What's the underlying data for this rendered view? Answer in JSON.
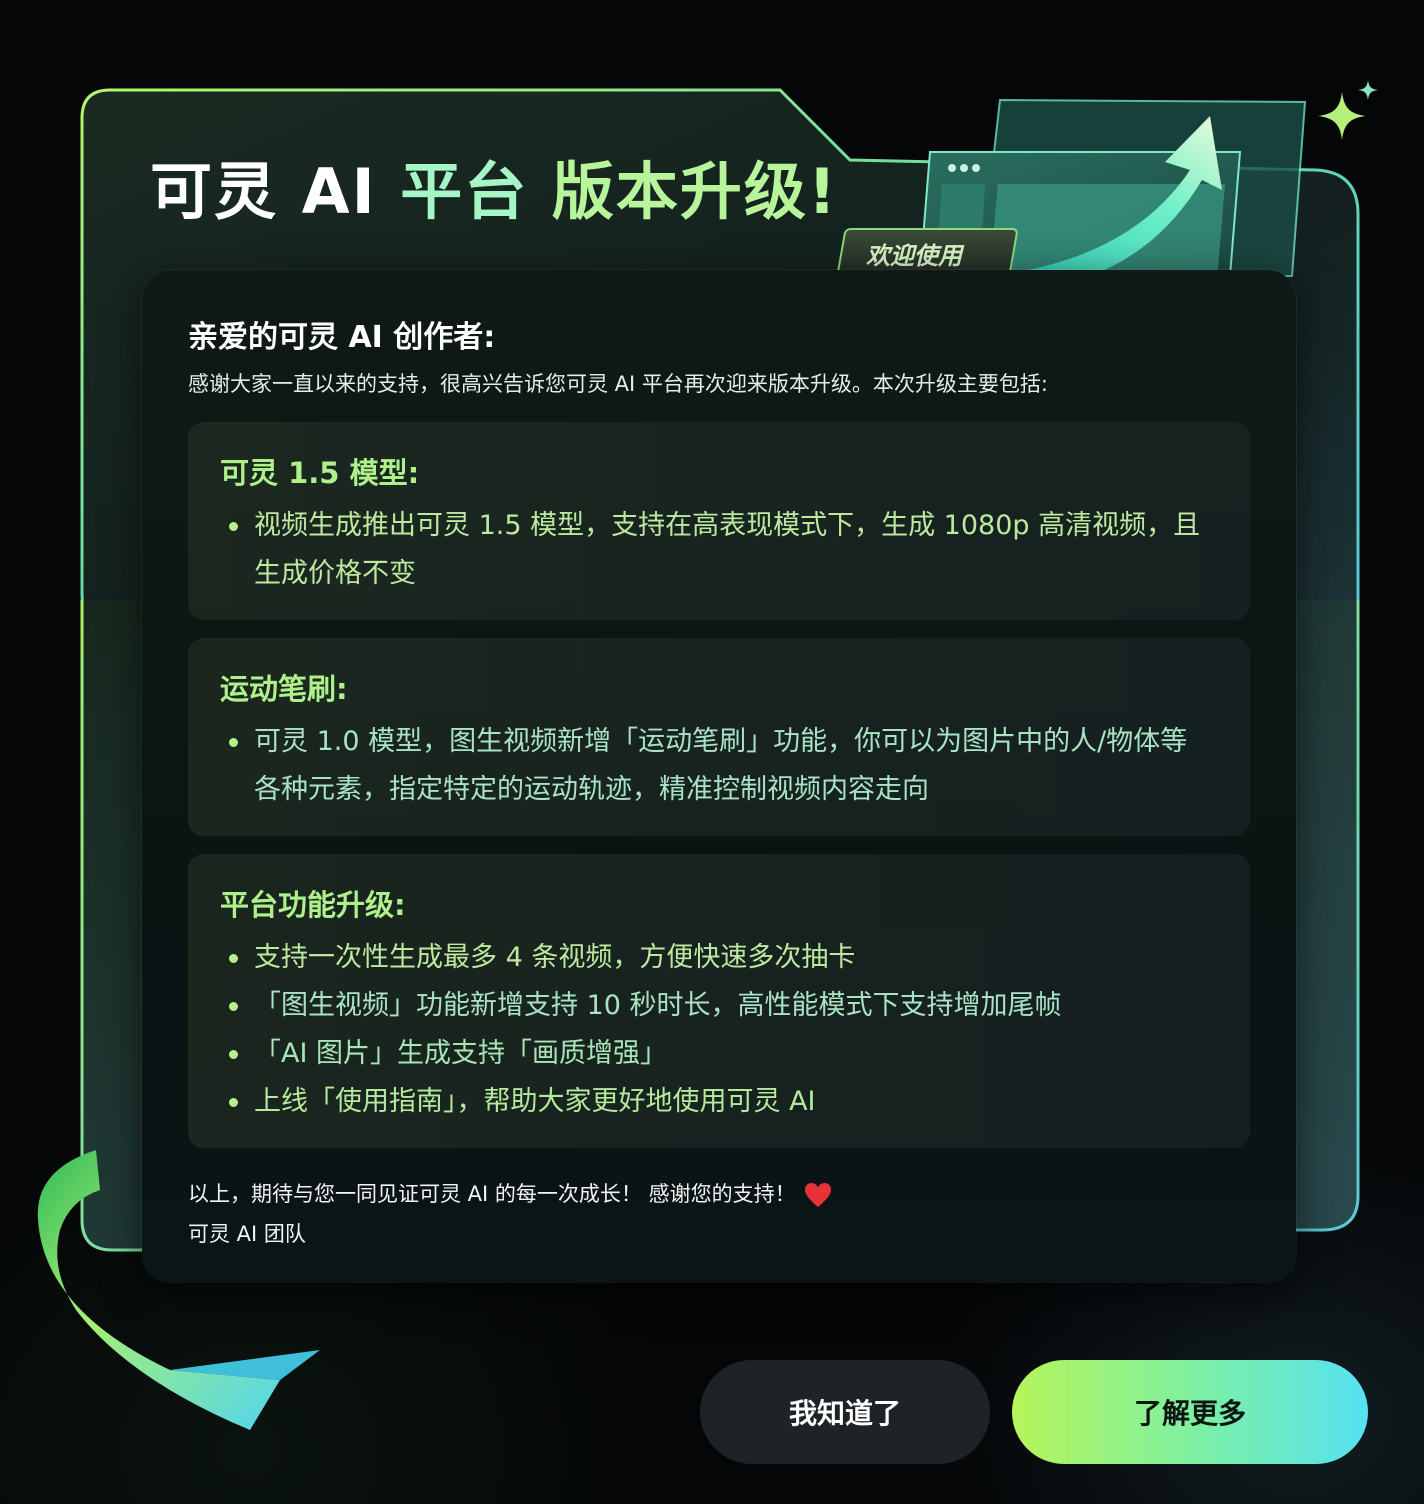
{
  "dialog": {
    "title_part1": "可灵 AI",
    "title_part2": "平台",
    "title_part3": "版本升级!",
    "welcome_tag": "欢迎使用",
    "greeting": "亲爱的可灵 AI 创作者:",
    "intro": "感谢大家一直以来的支持，很高兴告诉您可灵 AI 平台再次迎来版本升级。本次升级主要包括:",
    "sections": [
      {
        "title": "可灵 1.5 模型:",
        "bullets": [
          "视频生成推出可灵 1.5 模型，支持在高表现模式下，生成 1080p 高清视频，且",
          "生成价格不变"
        ]
      },
      {
        "title": "运动笔刷:",
        "bullets": [
          "可灵 1.0 模型，图生视频新增「运动笔刷」功能，你可以为图片中的人/物体等",
          "各种元素，指定特定的运动轨迹，精准控制视频内容走向"
        ]
      },
      {
        "title": "平台功能升级:",
        "bullets": [
          "支持一次性生成最多 4 条视频，方便快速多次抽卡",
          "「图生视频」功能新增支持 10 秒时长，高性能模式下支持增加尾帧",
          "「AI 图片」生成支持「画质增强」",
          "上线「使用指南」，帮助大家更好地使用可灵 AI"
        ]
      }
    ],
    "closing": "以上，期待与您一同见证可灵 AI 的每一次成长！ 感谢您的支持！",
    "signature": "可灵 AI 团队",
    "heart_icon": "heart-icon",
    "buttons": {
      "got_it": "我知道了",
      "learn_more": "了解更多"
    },
    "colors": {
      "accent_green": "#b6f55a",
      "accent_cyan": "#55e2f2",
      "section_title": "#aef08a",
      "heart": "#e8323a"
    }
  }
}
